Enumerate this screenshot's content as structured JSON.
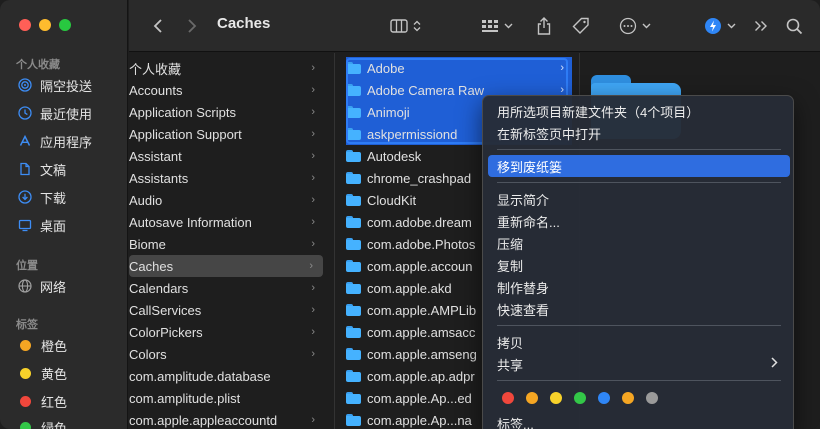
{
  "sidebar": {
    "favorites_header": "个人收藏",
    "favorites": [
      {
        "label": "隔空投送",
        "icon": "airdrop-icon"
      },
      {
        "label": "最近使用",
        "icon": "clock-icon"
      },
      {
        "label": "应用程序",
        "icon": "applications-icon"
      },
      {
        "label": "文稿",
        "icon": "document-icon"
      },
      {
        "label": "下载",
        "icon": "download-icon"
      },
      {
        "label": "桌面",
        "icon": "desktop-icon"
      }
    ],
    "locations_header": "位置",
    "locations": [
      {
        "label": "网络",
        "icon": "network-globe-icon"
      }
    ],
    "tags_header": "标签",
    "tags": [
      {
        "label": "橙色",
        "color": "#f5a623"
      },
      {
        "label": "黄色",
        "color": "#f8d22a"
      },
      {
        "label": "红色",
        "color": "#f0473c"
      },
      {
        "label": "绿色",
        "color": "#33c748"
      }
    ]
  },
  "toolbar": {
    "title": "Caches",
    "back_icon": "chevron-left-icon",
    "forward_icon": "chevron-right-icon",
    "view_icon": "column-view-icon",
    "group_icon": "grid-group-icon",
    "share_icon": "share-icon",
    "tag_icon": "tag-icon",
    "more_icon": "ellipsis-circle-icon",
    "extension_icon": "bolt-badge-icon",
    "overflow_icon": "double-chevron-icon",
    "search_icon": "search-icon"
  },
  "column1": {
    "items": [
      {
        "label": "个人收藏",
        "selected": false
      },
      {
        "label": "Accounts",
        "selected": false
      },
      {
        "label": "Application Scripts",
        "selected": false
      },
      {
        "label": "Application Support",
        "selected": false
      },
      {
        "label": "Assistant",
        "selected": false
      },
      {
        "label": "Assistants",
        "selected": false
      },
      {
        "label": "Audio",
        "selected": false
      },
      {
        "label": "Autosave Information",
        "selected": false
      },
      {
        "label": "Biome",
        "selected": false
      },
      {
        "label": "Caches",
        "selected": true
      },
      {
        "label": "Calendars",
        "selected": false
      },
      {
        "label": "CallServices",
        "selected": false
      },
      {
        "label": "ColorPickers",
        "selected": false
      },
      {
        "label": "Colors",
        "selected": false
      },
      {
        "label": "com.amplitude.database",
        "selected": false
      },
      {
        "label": "com.amplitude.plist",
        "selected": false
      },
      {
        "label": "com.apple.appleaccountd",
        "selected": false
      }
    ]
  },
  "column2": {
    "items": [
      {
        "label": "Adobe",
        "selected": true
      },
      {
        "label": "Adobe Camera Raw",
        "selected": true
      },
      {
        "label": "Animoji",
        "selected": true
      },
      {
        "label": "askpermissiond",
        "selected": true
      },
      {
        "label": "Autodesk",
        "selected": false
      },
      {
        "label": "chrome_crashpad",
        "selected": false
      },
      {
        "label": "CloudKit",
        "selected": false
      },
      {
        "label": "com.adobe.dream",
        "selected": false
      },
      {
        "label": "com.adobe.Photos",
        "selected": false
      },
      {
        "label": "com.apple.accoun",
        "selected": false
      },
      {
        "label": "com.apple.akd",
        "selected": false
      },
      {
        "label": "com.apple.AMPLib",
        "selected": false
      },
      {
        "label": "com.apple.amsacc",
        "selected": false
      },
      {
        "label": "com.apple.amseng",
        "selected": false
      },
      {
        "label": "com.apple.ap.adpr",
        "selected": false
      },
      {
        "label": "com.apple.Ap...ed",
        "selected": false
      },
      {
        "label": "com.apple.Ap...na",
        "selected": false
      }
    ]
  },
  "context_menu": {
    "new_folder_with_selection": "用所选项目新建文件夹（4个项目）",
    "open_in_new_tab": "在新标签页中打开",
    "move_to_trash": "移到废纸篓",
    "get_info": "显示简介",
    "rename": "重新命名...",
    "compress": "压缩",
    "duplicate": "复制",
    "make_alias": "制作替身",
    "quick_look": "快速查看",
    "copy": "拷贝",
    "share": "共享",
    "tags_item": "标签...",
    "tag_colors": [
      "#f0473c",
      "#f5a623",
      "#f8d22a",
      "#33c748",
      "#2f86f6",
      "#f5a623",
      "#9a9a9a"
    ]
  }
}
